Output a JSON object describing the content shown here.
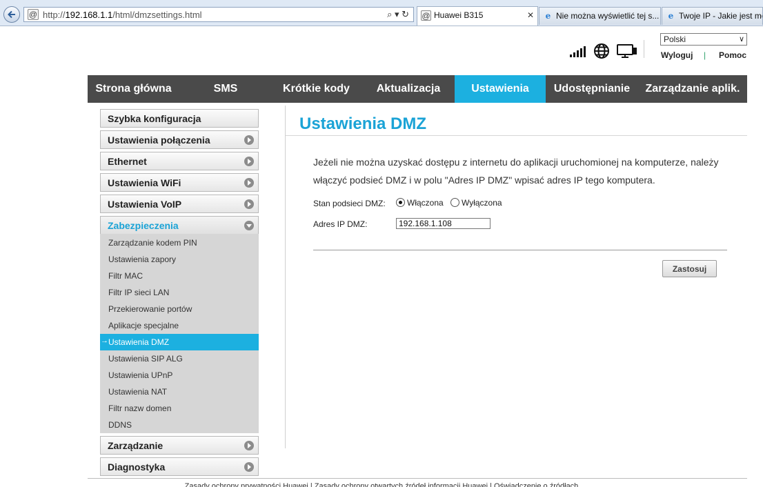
{
  "browser": {
    "url_prefix": "http://",
    "url_host": "192.168.1.1",
    "url_path": "/html/dmzsettings.html",
    "url_tools": "⌕ ▾ ↻",
    "tabs": [
      {
        "label": "Huawei B315",
        "close": "✕"
      },
      {
        "label": "Nie można wyświetlić tej s..."
      },
      {
        "label": "Twoje IP - Jakie jest mo"
      }
    ]
  },
  "header": {
    "language": "Polski",
    "logout": "Wyloguj",
    "help": "Pomoc",
    "pipe": "|"
  },
  "nav": [
    "Strona główna",
    "SMS",
    "Krótkie kody",
    "Aktualizacja",
    "Ustawienia",
    "Udostępnianie",
    "Zarządzanie aplik."
  ],
  "sidebar": {
    "sections": [
      "Szybka konfiguracja",
      "Ustawienia połączenia",
      "Ethernet",
      "Ustawienia WiFi",
      "Ustawienia VoIP",
      "Zabezpieczenia",
      "Zarządzanie",
      "Diagnostyka"
    ],
    "security_items": [
      "Zarządzanie kodem PIN",
      "Ustawienia zapory",
      "Filtr MAC",
      "Filtr IP sieci LAN",
      "Przekierowanie portów",
      "Aplikacje specjalne",
      "Ustawienia DMZ",
      "Ustawienia SIP ALG",
      "Ustawienia UPnP",
      "Ustawienia NAT",
      "Filtr nazw domen",
      "DDNS"
    ],
    "active_marker": "→"
  },
  "content": {
    "title": "Ustawienia DMZ",
    "description": "Jeżeli nie można uzyskać dostępu z internetu do aplikacji uruchomionej na komputerze, należy włączyć podsieć DMZ i w polu \"Adres IP DMZ\" wpisać adres IP tego komputera.",
    "dmz_status_label": "Stan podsieci DMZ:",
    "enabled_label": "Włączona",
    "disabled_label": "Wyłączona",
    "ip_label": "Adres IP DMZ:",
    "ip_value": "192.168.1.108",
    "apply": "Zastosuj"
  },
  "footer": {
    "text": "Zasady ochrony prywatności Huawei | Zasady ochrony otwartych źródeł informacji Huawei | Oświadczenie o źródłach"
  }
}
